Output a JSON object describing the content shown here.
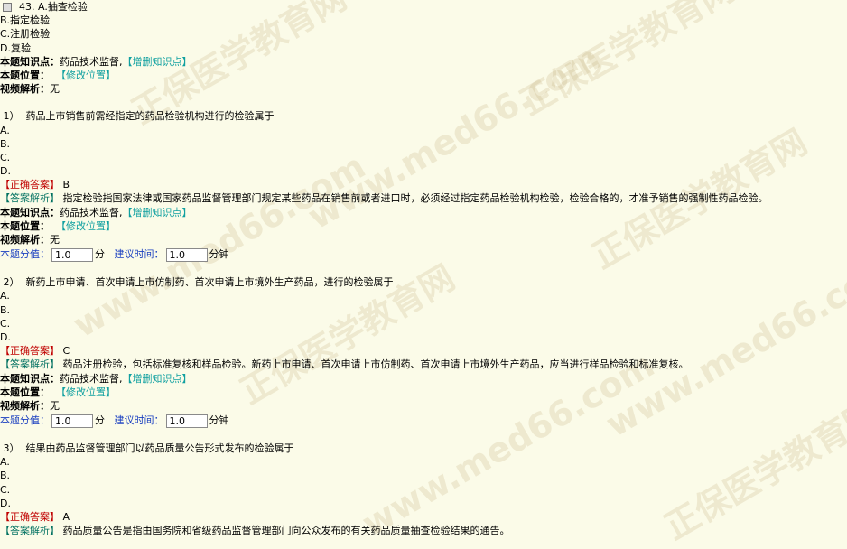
{
  "top": {
    "number": "43.",
    "options": [
      "A.抽查检验",
      "B.指定检验",
      "C.注册检验",
      "D.复验"
    ],
    "knowledge_label": "本题知识点：",
    "knowledge_value": "药品技术监督,",
    "knowledge_link": "【增删知识点】",
    "position_label": "本题位置：",
    "position_link": "【修改位置】",
    "video_label": "视频解析：",
    "video_value": "无"
  },
  "labels": {
    "correct": "【正确答案】",
    "analysis": "【答案解析】",
    "knowledge": "本题知识点：",
    "knowledge_link": "【增删知识点】",
    "position": "本题位置：",
    "position_link": "【修改位置】",
    "video": "视频解析：",
    "score": "本题分值：",
    "score_unit": "分",
    "time": "建议时间：",
    "time_unit": "分钟"
  },
  "questions": [
    {
      "number": "1）",
      "text": "药品上市销售前需经指定的药品检验机构进行的检验属于",
      "options": [
        "A.",
        "B.",
        "C.",
        "D."
      ],
      "answer": "B",
      "analysis": "指定检验指国家法律或国家药品监督管理部门规定某些药品在销售前或者进口时，必须经过指定药品检验机构检验，检验合格的，才准予销售的强制性药品检验。",
      "knowledge": "药品技术监督,",
      "video": "无",
      "score": "1.0",
      "time": "1.0"
    },
    {
      "number": "2）",
      "text": "新药上市申请、首次申请上市仿制药、首次申请上市境外生产药品，进行的检验属于",
      "options": [
        "A.",
        "B.",
        "C.",
        "D."
      ],
      "answer": "C",
      "analysis": "药品注册检验，包括标准复核和样品检验。新药上市申请、首次申请上市仿制药、首次申请上市境外生产药品，应当进行样品检验和标准复核。",
      "knowledge": "药品技术监督,",
      "video": "无",
      "score": "1.0",
      "time": "1.0"
    },
    {
      "number": "3）",
      "text": "结果由药品监督管理部门以药品质量公告形式发布的检验属于",
      "options": [
        "A.",
        "B.",
        "C.",
        "D."
      ],
      "answer": "A",
      "analysis": "药品质量公告是指由国务院和省级药品监督管理部门向公众发布的有关药品质量抽查检验结果的通告。"
    }
  ],
  "watermark": [
    "正保医学教育网",
    "www.med66.com"
  ]
}
